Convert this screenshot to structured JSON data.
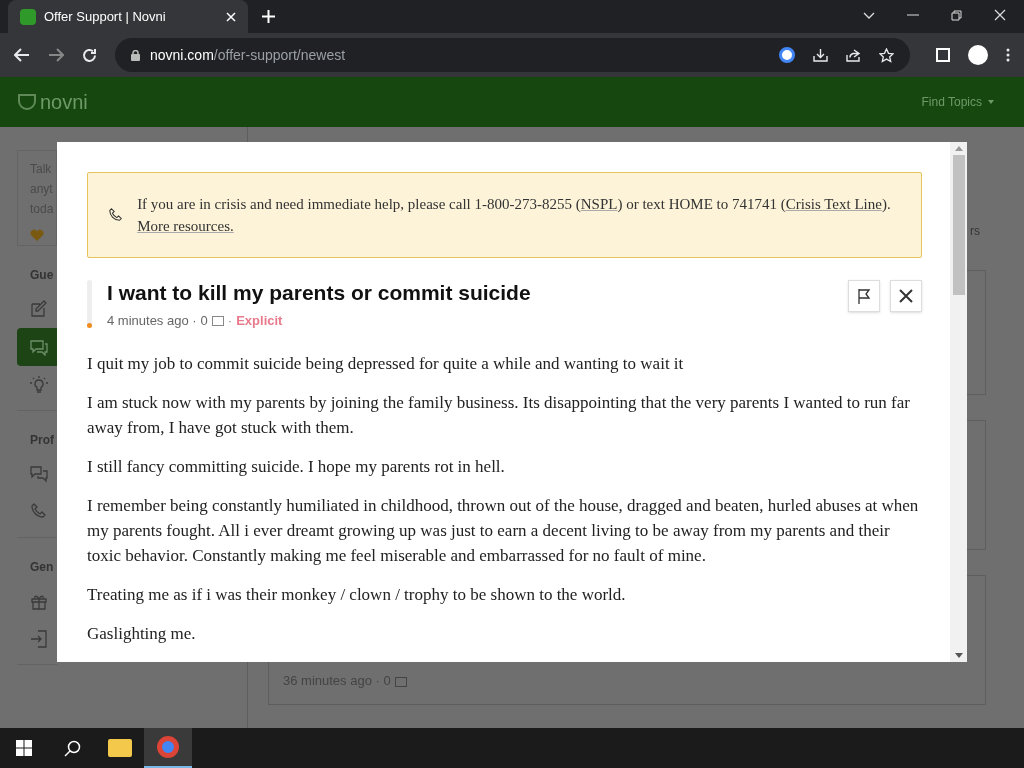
{
  "browser": {
    "tab_title": "Offer Support | Novni",
    "url_host": "novni.com",
    "url_path": "/offer-support/newest"
  },
  "site": {
    "logo": "novni",
    "nav": "Find Topics"
  },
  "background": {
    "intro_lines": [
      "Talk",
      "anyt",
      "toda"
    ],
    "sections": [
      {
        "label": "Gue",
        "items": [
          {
            "selected": false
          },
          {
            "selected": true
          },
          {
            "selected": false
          }
        ]
      },
      {
        "label": "Prof",
        "items": [
          {
            "selected": false
          },
          {
            "selected": false
          }
        ]
      },
      {
        "label": "Gen",
        "items": [
          {
            "selected": false
          },
          {
            "selected": false
          }
        ]
      }
    ],
    "filter_text": "rs",
    "card_meta": "36 minutes ago · 0"
  },
  "modal": {
    "banner": [
      {
        "kind": "text",
        "text": "If you are in crisis and need immediate help, please call 1-800-273-8255 ("
      },
      {
        "kind": "link",
        "text": "NSPL"
      },
      {
        "kind": "text",
        "text": ") or text HOME to 741741 ("
      },
      {
        "kind": "link",
        "text": "Crisis Text Line"
      },
      {
        "kind": "text",
        "text": "). "
      },
      {
        "kind": "link",
        "text": "More resources."
      }
    ],
    "title": "I want to kill my parents or commit suicide",
    "time": "4 minutes ago ·",
    "comments": "0",
    "separator": "·",
    "tag": "Explicit",
    "paragraphs": [
      "I quit my job to commit suicide being depressed for quite a while and wanting to wait it",
      "I am stuck now with my parents by joining the family business. Its disappointing that the very parents I wanted to run far away from, I have got stuck with them.",
      "I still fancy committing suicide. I hope my parents rot in hell.",
      "I remember being constantly humiliated in childhood, thrown out of the house, dragged and beaten, hurled abuses at when my parents fought. All i ever dreamt growing up was just to earn a decent living to be away from my parents and their toxic behavior. Constantly making me feel miserable and embarrassed for no fault of mine.",
      "Treating me as if i was their monkey / clown / trophy to be shown to the world.",
      "Gaslighting me."
    ]
  }
}
